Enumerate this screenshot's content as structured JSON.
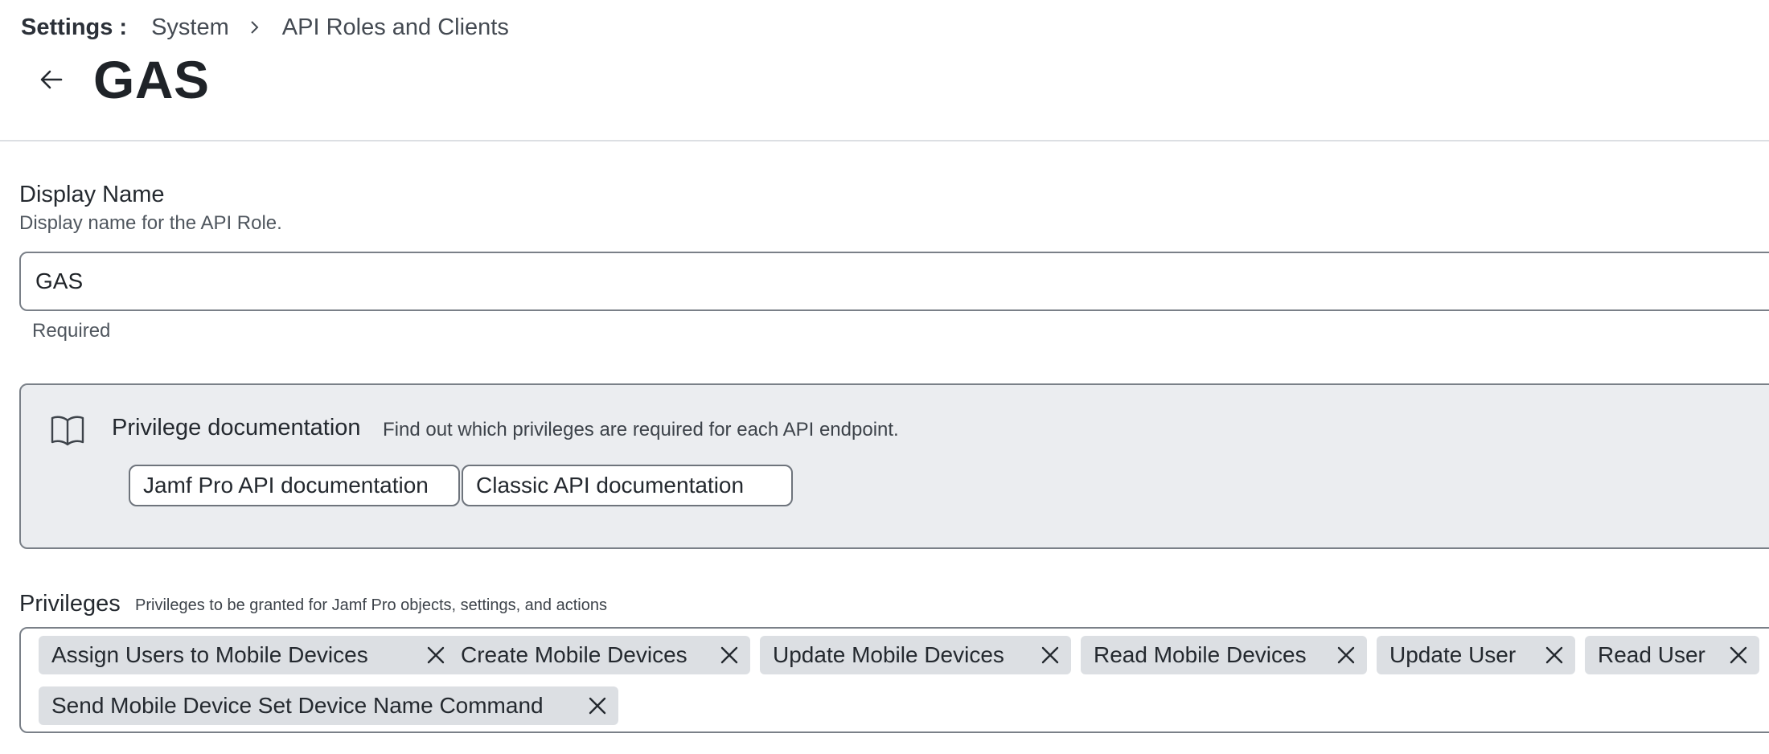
{
  "breadcrumb": {
    "root": "Settings",
    "colon": ":",
    "items": [
      "System",
      "API Roles and Clients"
    ]
  },
  "header": {
    "title": "GAS",
    "back_icon": "arrow-left-icon"
  },
  "display_name": {
    "label": "Display Name",
    "help": "Display name for the API Role.",
    "value": "GAS",
    "note": "Required"
  },
  "privilege_docs": {
    "icon": "book-open-icon",
    "title": "Privilege documentation",
    "description": "Find out which privileges are required for each API endpoint.",
    "buttons": [
      "Jamf Pro API documentation",
      "Classic API documentation"
    ]
  },
  "privileges": {
    "label": "Privileges",
    "help": "Privileges to be granted for Jamf Pro objects, settings, and actions",
    "chips": [
      "Assign Users to Mobile Devices",
      "Create Mobile Devices",
      "Update Mobile Devices",
      "Read Mobile Devices",
      "Update User",
      "Read User",
      "Send Mobile Device Set Device Name Command"
    ],
    "remove_icon": "close-icon"
  },
  "colors": {
    "panel_bg": "#ebedf0",
    "chip_bg": "#dcdfe3",
    "border": "#7a8088",
    "text": "#1f2328"
  }
}
